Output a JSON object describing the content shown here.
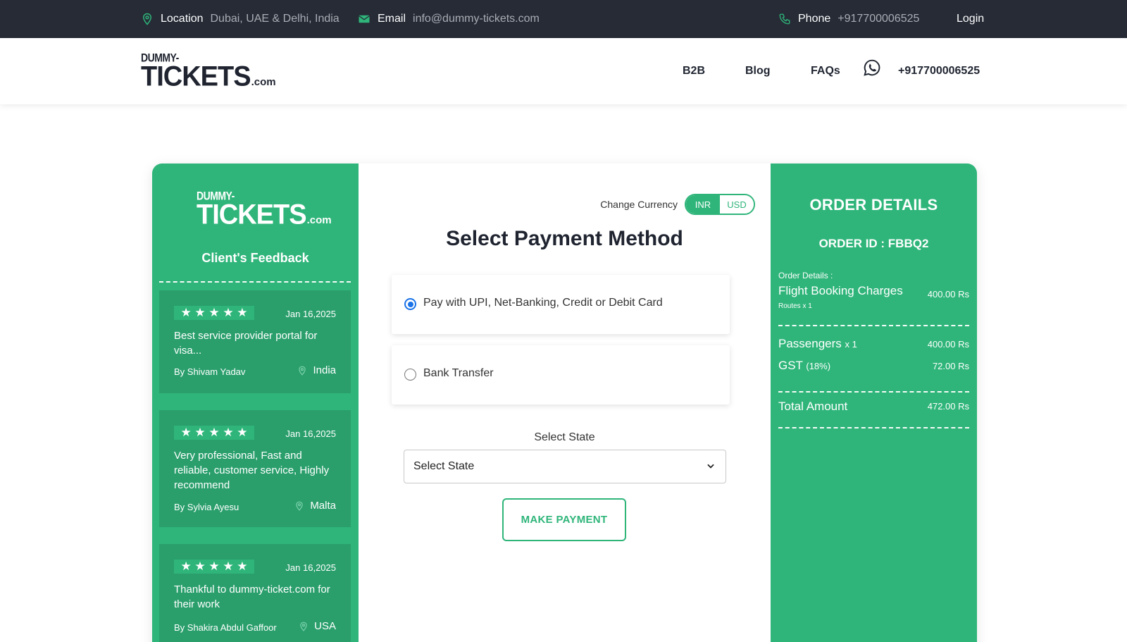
{
  "topbar": {
    "location_label": "Location",
    "location_value": "Dubai, UAE & Delhi, India",
    "email_label": "Email",
    "email_value": "info@dummy-tickets.com",
    "phone_label": "Phone",
    "phone_value": "+917700006525",
    "login_label": "Login"
  },
  "header": {
    "logo_line1": "DUMMY-",
    "logo_line2": "TICKETS",
    "logo_suffix": ".com",
    "nav": {
      "b2b": "B2B",
      "blog": "Blog",
      "faqs": "FAQs"
    },
    "phone": "+917700006525"
  },
  "feedback": {
    "title": "Client's Feedback",
    "reviews": [
      {
        "stars": "★ ★ ★ ★ ★",
        "date": "Jan 16,2025",
        "text": "Best service provider portal for visa...",
        "by": "By Shivam Yadav",
        "location": "India"
      },
      {
        "stars": "★ ★ ★ ★ ★",
        "date": "Jan 16,2025",
        "text": "Very professional, Fast and reliable, customer service, Highly recommend",
        "by": "By Sylvia Ayesu",
        "location": "Malta"
      },
      {
        "stars": "★ ★ ★ ★ ★",
        "date": "Jan 16,2025",
        "text": "Thankful to dummy-ticket.com for their work",
        "by": "By Shakira Abdul Gaffoor",
        "location": "USA"
      }
    ]
  },
  "payment": {
    "change_currency_label": "Change Currency",
    "currency_options": [
      "INR",
      "USD"
    ],
    "selected_currency": "INR",
    "title": "Select Payment Method",
    "options": [
      {
        "label": "Pay with UPI, Net-Banking, Credit or Debit Card",
        "selected": true
      },
      {
        "label": "Bank Transfer",
        "selected": false
      }
    ],
    "state_label": "Select State",
    "state_value": "Select State",
    "button_label": "MAKE PAYMENT"
  },
  "order": {
    "title": "ORDER DETAILS",
    "order_id": "ORDER ID : FBBQ2",
    "details_label": "Order Details :",
    "flight_label": "Flight Booking Charges",
    "flight_amount": "400.00 Rs",
    "routes": "Routes x 1",
    "passengers_label": "Passengers",
    "passengers_count": "x 1",
    "passengers_amount": "400.00 Rs",
    "gst_label": "GST",
    "gst_rate": "(18%)",
    "gst_amount": "72.00 Rs",
    "total_label": "Total Amount",
    "total_amount": "472.00 Rs"
  },
  "colors": {
    "brand_green": "#2fb57a",
    "topbar_bg": "#262b36",
    "radio_blue": "#1a73e8"
  }
}
